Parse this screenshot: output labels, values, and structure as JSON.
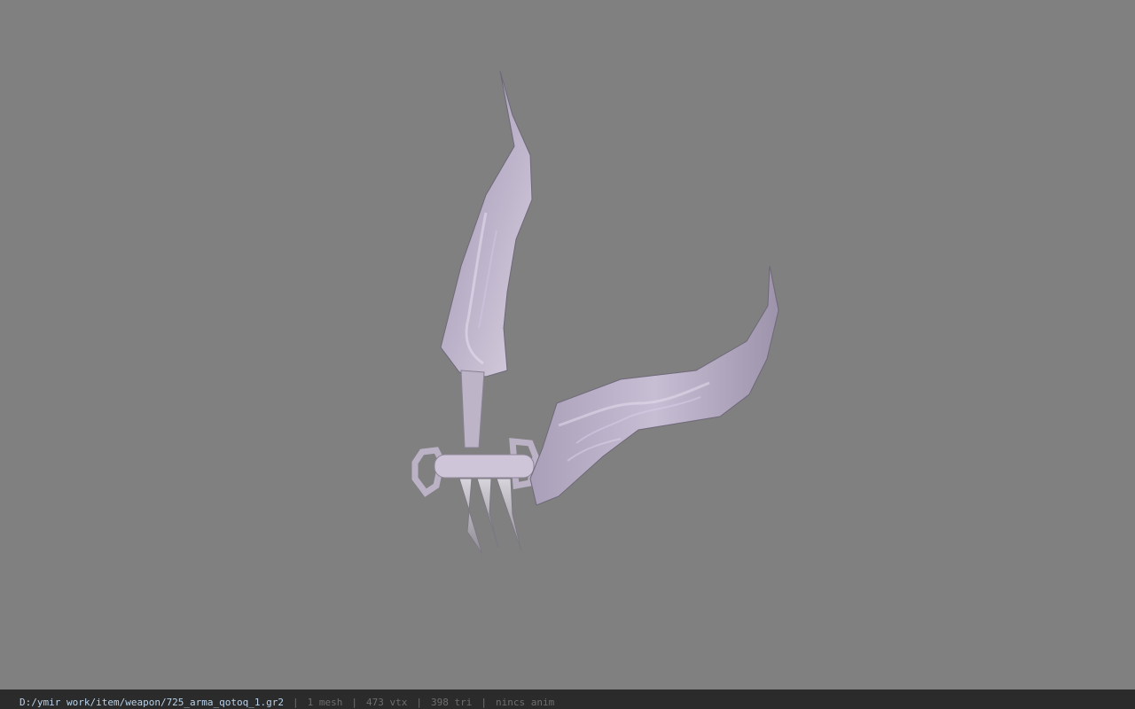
{
  "viewport": {
    "background": "#808080",
    "model_color": "#c9bfd3"
  },
  "status": {
    "path": "D:/ymir work/item/weapon/725_arma_qotoq_1.gr2",
    "separator": "|",
    "mesh": "1 mesh",
    "vertices": "473 vtx",
    "triangles": "398 tri",
    "anim": "nincs anim"
  }
}
